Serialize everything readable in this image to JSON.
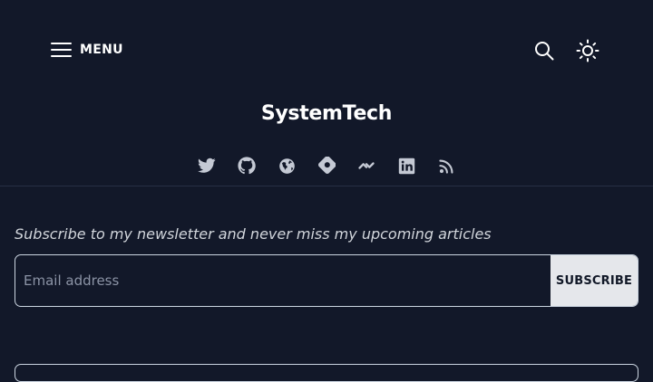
{
  "header": {
    "menu_label": "MENU",
    "search_icon": "search-icon",
    "theme_icon": "sun-icon"
  },
  "site": {
    "title": "SystemTech"
  },
  "socials": [
    {
      "name": "twitter-icon"
    },
    {
      "name": "github-icon"
    },
    {
      "name": "globe-icon"
    },
    {
      "name": "hashnode-icon"
    },
    {
      "name": "polywork-icon"
    },
    {
      "name": "linkedin-icon"
    },
    {
      "name": "rss-icon"
    }
  ],
  "newsletter": {
    "prompt": "Subscribe to my newsletter and never miss my upcoming articles",
    "email_placeholder": "Email address",
    "email_value": "",
    "subscribe_label": "SUBSCRIBE"
  },
  "colors": {
    "background": "#121829",
    "icon": "#c4c9d4",
    "button_bg": "#e5e7eb"
  }
}
